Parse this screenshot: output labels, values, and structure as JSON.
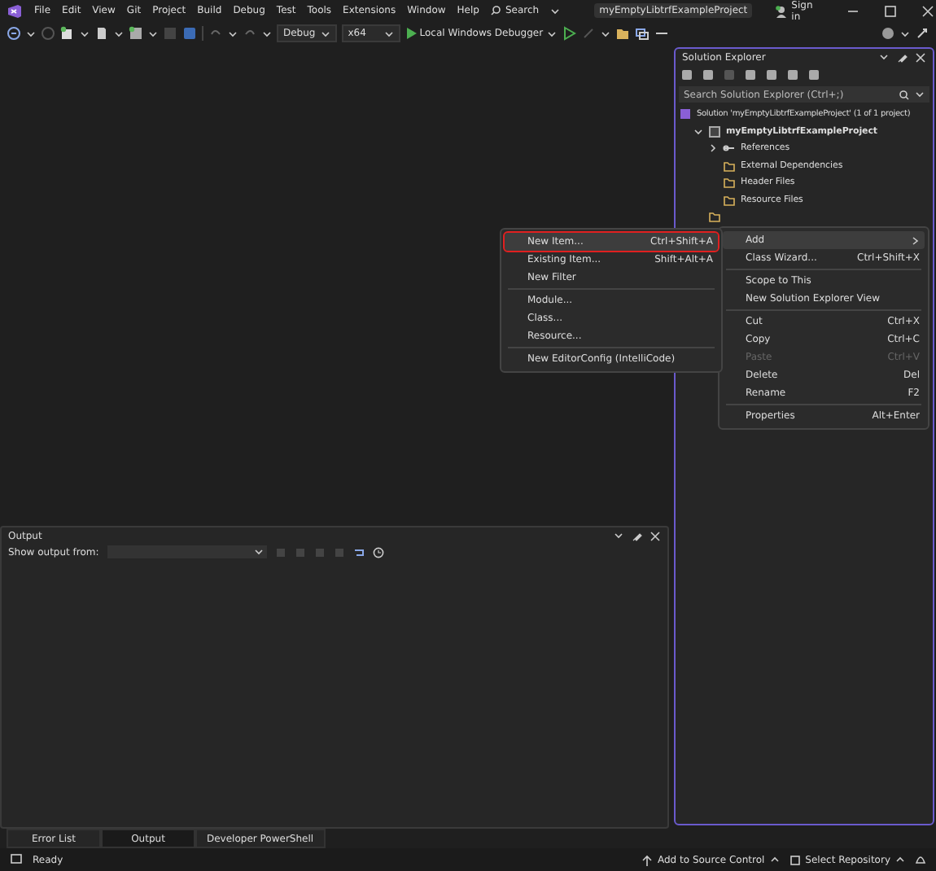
{
  "menu_bar": {
    "items": [
      "File",
      "Edit",
      "View",
      "Git",
      "Project",
      "Build",
      "Debug",
      "Test",
      "Tools",
      "Extensions",
      "Window",
      "Help"
    ],
    "search": "Search",
    "project_name": "myEmptyLibtrfExampleProject",
    "sign_in": "Sign in"
  },
  "toolbar": {
    "configuration": "Debug",
    "platform": "x64",
    "run": "Local Windows Debugger"
  },
  "output": {
    "title": "Output",
    "show_output_from": "Show output from:"
  },
  "bottom_tabs": [
    {
      "label": "Error List",
      "selected": false
    },
    {
      "label": "Output",
      "selected": true
    },
    {
      "label": "Developer PowerShell",
      "selected": false
    }
  ],
  "solution_explorer": {
    "title": "Solution Explorer",
    "search": {
      "placeholder": "Search Solution Explorer (Ctrl+;)"
    },
    "tree": [
      {
        "label": "Solution 'myEmptyLibtrfExampleProject' (1 of 1 project)",
        "kind": "solution",
        "children": [
          {
            "label": "myEmptyLibtrfExampleProject",
            "kind": "project",
            "expanded": true,
            "children": [
              {
                "label": "References",
                "kind": "references",
                "expanded": false
              },
              {
                "label": "External Dependencies",
                "kind": "folder"
              },
              {
                "label": "Header Files",
                "kind": "folder"
              },
              {
                "label": "Resource Files",
                "kind": "folder"
              }
            ]
          }
        ]
      }
    ]
  },
  "context_menu": [
    {
      "kind": "item",
      "label": "Add",
      "submenu": true,
      "selected": true,
      "disabled": false
    },
    {
      "kind": "item",
      "label": "Class Wizard...",
      "shortcut": "Ctrl+Shift+X",
      "selected": false,
      "disabled": false
    },
    {
      "kind": "separator"
    },
    {
      "kind": "item",
      "label": "Scope to This",
      "selected": false,
      "disabled": false
    },
    {
      "kind": "item",
      "label": "New Solution Explorer View",
      "selected": false,
      "disabled": false
    },
    {
      "kind": "separator"
    },
    {
      "kind": "item",
      "label": "Cut",
      "shortcut": "Ctrl+X",
      "selected": false,
      "disabled": false
    },
    {
      "kind": "item",
      "label": "Copy",
      "shortcut": "Ctrl+C",
      "selected": false,
      "disabled": false
    },
    {
      "kind": "item",
      "label": "Paste",
      "shortcut": "Ctrl+V",
      "selected": false,
      "disabled": true
    },
    {
      "kind": "item",
      "label": "Delete",
      "shortcut": "Del",
      "selected": false,
      "disabled": false
    },
    {
      "kind": "item",
      "label": "Rename",
      "shortcut": "F2",
      "selected": false,
      "disabled": false
    },
    {
      "kind": "separator"
    },
    {
      "kind": "item",
      "label": "Properties",
      "shortcut": "Alt+Enter",
      "selected": false,
      "disabled": false
    }
  ],
  "add_submenu": [
    {
      "kind": "item",
      "label": "New Item...",
      "shortcut": "Ctrl+Shift+A",
      "selected": true,
      "outlined": true
    },
    {
      "kind": "item",
      "label": "Existing Item...",
      "shortcut": "Shift+Alt+A",
      "selected": false,
      "outlined": false
    },
    {
      "kind": "item",
      "label": "New Filter",
      "selected": false,
      "outlined": false
    },
    {
      "kind": "separator"
    },
    {
      "kind": "item",
      "label": "Module...",
      "selected": false,
      "outlined": false
    },
    {
      "kind": "item",
      "label": "Class...",
      "selected": false,
      "outlined": false
    },
    {
      "kind": "item",
      "label": "Resource...",
      "selected": false,
      "outlined": false
    },
    {
      "kind": "separator"
    },
    {
      "kind": "item",
      "label": "New EditorConfig (IntelliCode)",
      "selected": false,
      "outlined": false
    }
  ],
  "status_bar": {
    "status": "Ready",
    "source_control": "Add to Source Control",
    "repository": "Select Repository"
  }
}
